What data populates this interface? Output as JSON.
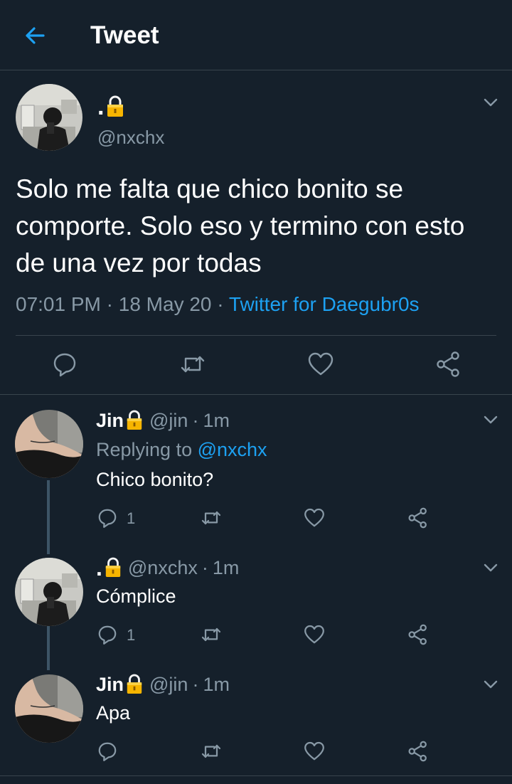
{
  "header": {
    "title": "Tweet"
  },
  "main_tweet": {
    "name_dot": ".",
    "handle": "@nxchx",
    "text": "Solo me falta que chico bonito se comporte. Solo eso y termino con esto de una vez por todas",
    "time": "07:01 PM",
    "date": "18 May 20",
    "source": "Twitter for Daegubr0s"
  },
  "replies": [
    {
      "name": "Jin",
      "handle": "@jin",
      "time": "1m",
      "replying_label": "Replying to",
      "replying_to": "@nxchx",
      "text": "Chico bonito?",
      "reply_count": "1"
    },
    {
      "name": ".",
      "handle": "@nxchx",
      "time": "1m",
      "text": "Cómplice",
      "reply_count": "1"
    },
    {
      "name": "Jin",
      "handle": "@jin",
      "time": "1m",
      "text": "Apa"
    }
  ],
  "colors": {
    "background": "#15202b",
    "accent": "#1da1f2",
    "muted": "#8899a6",
    "divider": "#38444d"
  }
}
